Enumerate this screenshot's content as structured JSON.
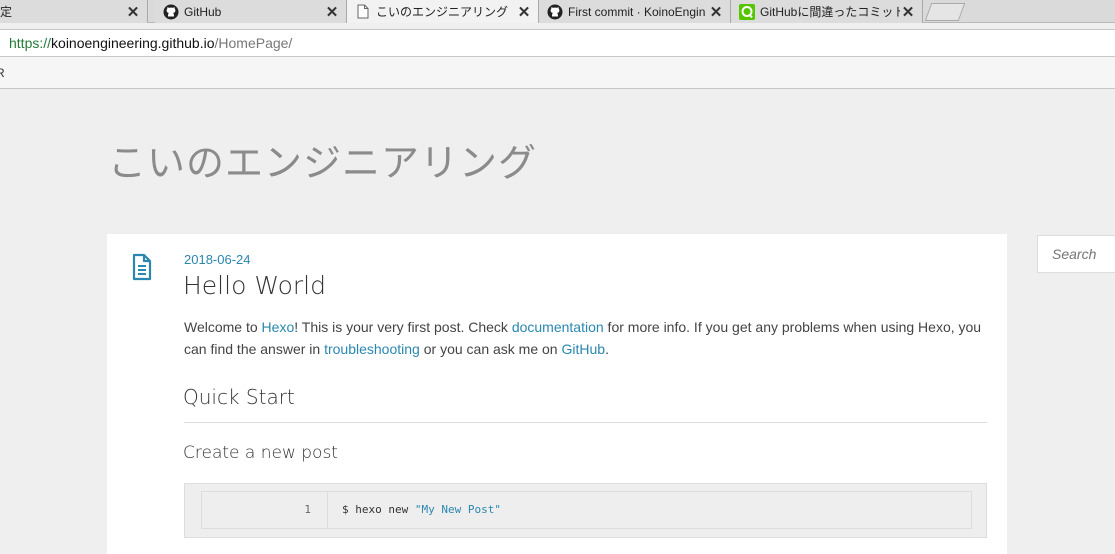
{
  "tabs": [
    {
      "title": "定",
      "icon": "partial-icon",
      "active": false
    },
    {
      "title": "GitHub",
      "icon": "github-icon",
      "active": false
    },
    {
      "title": "こいのエンジニアリング",
      "icon": "page-icon",
      "active": true
    },
    {
      "title": "First commit · KoinoEngin",
      "icon": "github-icon",
      "active": false
    },
    {
      "title": "GitHubに間違ったコミットを",
      "icon": "qiita-icon",
      "active": false
    }
  ],
  "address": {
    "secure": "https://",
    "host": "koinoengineering.github.io",
    "path": "/HomePage/"
  },
  "bookmarks": {
    "left_fragment": "R"
  },
  "site": {
    "title": "こいのエンジニアリング"
  },
  "post": {
    "date": "2018-06-24",
    "title": "Hello World",
    "p1_pre": "Welcome to ",
    "link_hexo": "Hexo",
    "p1_mid": "! This is your very first post. Check ",
    "link_docs": "documentation",
    "p1_post": " for more info. If you get any problems when using Hexo, you can find the answer in ",
    "link_trouble": "troubleshooting",
    "p1_end": " or you can ask me on ",
    "link_github": "GitHub",
    "p1_final": ".",
    "h2": "Quick Start",
    "h3": "Create a new post",
    "code_line_no": "1",
    "code_cmd": "$ hexo new ",
    "code_str": "\"My New Post\""
  },
  "search": {
    "placeholder": "Search"
  },
  "colors": {
    "link": "#2a87b0",
    "background": "#efefef",
    "card": "#ffffff"
  }
}
